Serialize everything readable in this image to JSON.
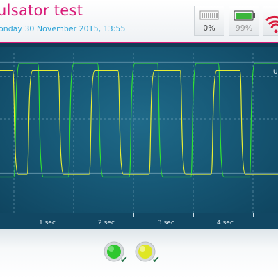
{
  "header": {
    "title": "ulsator test",
    "datetime": "onday 30 November 2015, 13:55",
    "status": [
      {
        "label": "0%",
        "icon": "signal-bars-icon"
      },
      {
        "label": "99%",
        "icon": "battery-icon",
        "level": 0.99,
        "color": "#3cb63c"
      },
      {
        "icon": "wifi-icon",
        "color": "#d81b3c"
      }
    ],
    "accent_color": "#d81b78"
  },
  "chart_data": {
    "type": "line",
    "x_ticks": [
      "1 sec",
      "2 sec",
      "3 sec",
      "4 sec"
    ],
    "edge_label": "U",
    "series": [
      {
        "color": "#31e231",
        "rise_times": [
          0.0,
          0.91,
          1.93,
          2.96,
          3.94
        ],
        "fall_times": [
          0.4,
          1.4,
          2.4,
          3.42,
          4.42
        ],
        "high": 0.96,
        "low": 0.02
      },
      {
        "color": "#e7ee35",
        "rise_times": [
          0.22,
          1.26,
          2.26,
          3.3
        ],
        "fall_times": [
          -0.02,
          0.74,
          1.74,
          2.78,
          3.78
        ],
        "high": 0.9,
        "low": 0.04
      }
    ]
  },
  "footer": {
    "channels": [
      {
        "color": "#2fc72f",
        "checked": true,
        "icon": "green-channel-icon"
      },
      {
        "color": "#dfe625",
        "checked": true,
        "icon": "yellow-channel-icon"
      }
    ],
    "check_glyph": "✔"
  }
}
